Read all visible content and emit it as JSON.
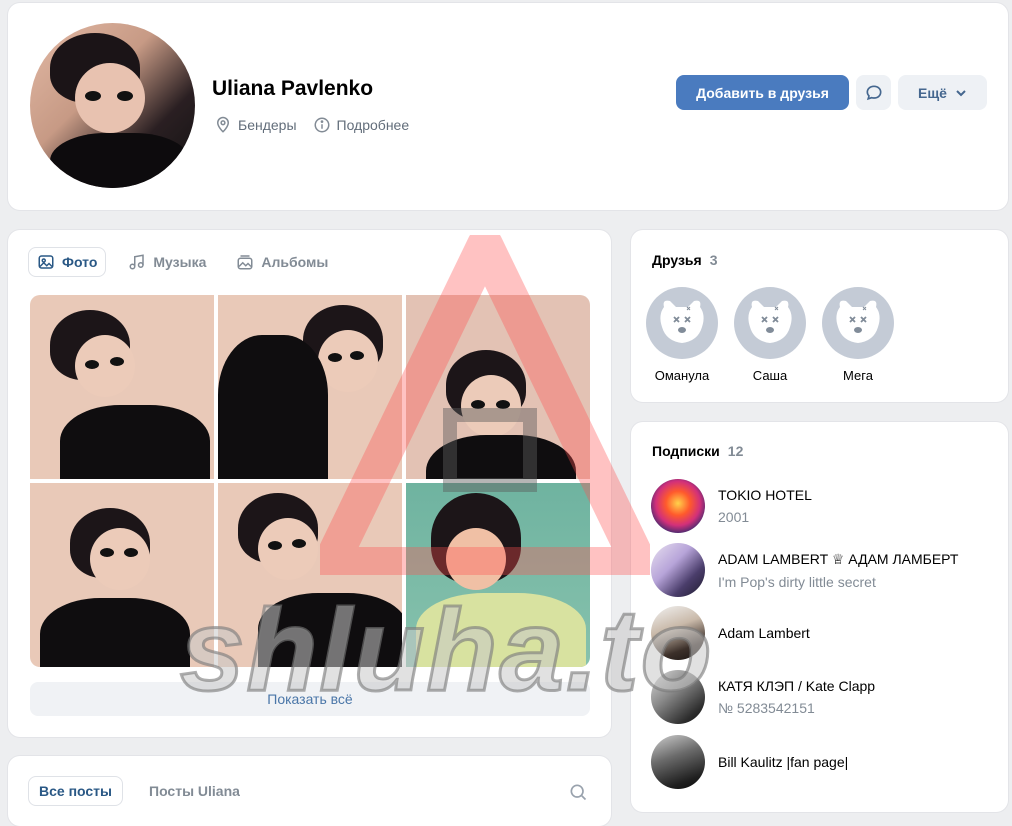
{
  "profile": {
    "name": "Uliana Pavlenko",
    "location": "Бендеры",
    "details_label": "Подробнее",
    "add_friend_label": "Добавить в друзья",
    "more_label": "Ещё"
  },
  "photos": {
    "tabs": [
      {
        "label": "Фото",
        "icon": "image-icon"
      },
      {
        "label": "Музыка",
        "icon": "music-note-icon"
      },
      {
        "label": "Альбомы",
        "icon": "albums-icon"
      }
    ],
    "show_all_label": "Показать всё"
  },
  "posts": {
    "tabs": [
      "Все посты",
      "Посты Uliana"
    ]
  },
  "friends": {
    "title": "Друзья",
    "count": "3",
    "items": [
      {
        "name": "Оманула"
      },
      {
        "name": "Саша"
      },
      {
        "name": "Мега"
      }
    ]
  },
  "subscriptions": {
    "title": "Подписки",
    "count": "12",
    "items": [
      {
        "name": "TOKIO HOTEL",
        "desc": "2001"
      },
      {
        "name": "ADAM LAMBERT ♕ АДАМ ЛАМБЕРТ",
        "desc": "I'm Pop's dirty little secret"
      },
      {
        "name": "Adam Lambert",
        "desc": ""
      },
      {
        "name": "КАТЯ КЛЭП / Kate Clapp",
        "desc": "№ 5283542151"
      },
      {
        "name": "Bill Kaulitz |fan page|",
        "desc": ""
      }
    ]
  },
  "watermark": {
    "text": "shluha.to"
  },
  "colors": {
    "accent": "#4a7bbf",
    "link": "#2a5885",
    "muted": "#828b95",
    "background": "#edeef0"
  }
}
